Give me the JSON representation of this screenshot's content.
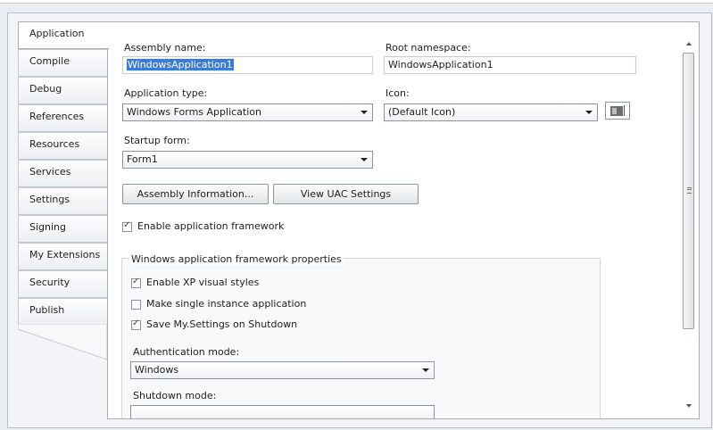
{
  "tabs": [
    {
      "label": "Application",
      "active": true
    },
    {
      "label": "Compile"
    },
    {
      "label": "Debug"
    },
    {
      "label": "References"
    },
    {
      "label": "Resources"
    },
    {
      "label": "Services"
    },
    {
      "label": "Settings"
    },
    {
      "label": "Signing"
    },
    {
      "label": "My Extensions"
    },
    {
      "label": "Security"
    },
    {
      "label": "Publish"
    }
  ],
  "form": {
    "assembly_name_label": "Assembly name:",
    "assembly_name_value": "WindowsApplication1",
    "root_namespace_label": "Root namespace:",
    "root_namespace_value": "WindowsApplication1",
    "application_type_label": "Application type:",
    "application_type_value": "Windows Forms Application",
    "icon_label": "Icon:",
    "icon_value": "(Default Icon)",
    "startup_form_label": "Startup form:",
    "startup_form_value": "Form1",
    "assembly_info_button": "Assembly Information...",
    "view_uac_button": "View UAC Settings",
    "enable_framework_label": "Enable application framework",
    "enable_framework_checked": true
  },
  "framework_props": {
    "group_title": "Windows application framework properties",
    "xp_styles_label": "Enable XP visual styles",
    "xp_styles_checked": true,
    "single_instance_label": "Make single instance application",
    "single_instance_checked": false,
    "save_settings_label": "Save My.Settings on Shutdown",
    "save_settings_checked": true,
    "auth_mode_label": "Authentication mode:",
    "auth_mode_value": "Windows",
    "shutdown_mode_label": "Shutdown mode:"
  },
  "colors": {
    "selection": "#3b7bd4",
    "panel_bg": "#ffffff",
    "frame_bg": "#f2f4f7"
  },
  "icons": [
    "check-icon",
    "dropdown-arrow-icon",
    "app-icon-preview",
    "scroll-up-icon",
    "scroll-down-icon",
    "scroll-grip-icon"
  ]
}
